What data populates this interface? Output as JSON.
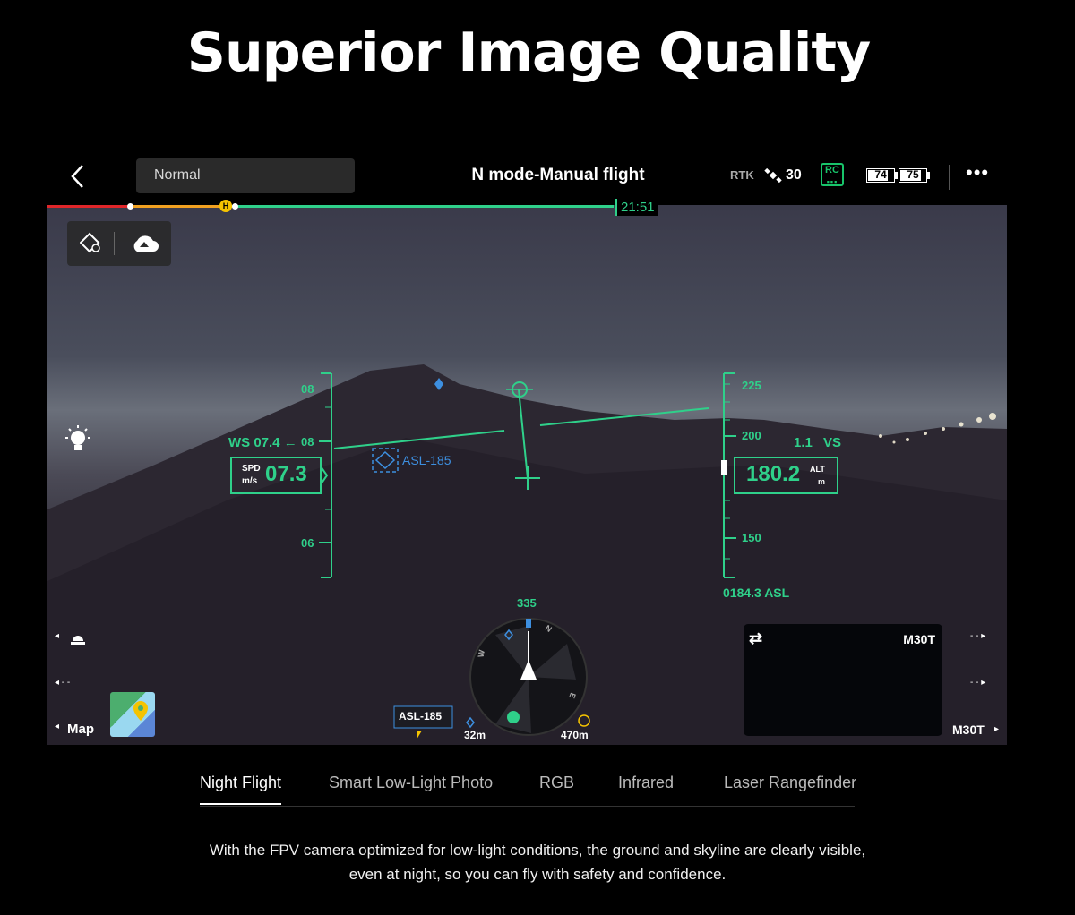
{
  "page": {
    "title": "Superior Image Quality",
    "description_line1": "With the FPV camera optimized for low-light conditions, the ground and skyline are clearly visible,",
    "description_line2": "even at night, so you can fly with safety and confidence."
  },
  "topbar": {
    "back_icon": "chevron-left-icon",
    "mode_value": "Normal",
    "flight_mode": "N mode-Manual flight",
    "rtk_label": "RTK",
    "satellite_count": "30",
    "rc_label": "RC",
    "battery_left": "74",
    "battery_right": "75",
    "more_icon": "more-dots-icon"
  },
  "progress": {
    "home_marker": "H",
    "time_remaining": "21:51"
  },
  "hud": {
    "ws_label": "WS 07.4 ←",
    "speed_label": "SPD",
    "speed_unit": "m/s",
    "speed_value": "07.3",
    "speed_ticks": [
      "08",
      "06"
    ],
    "speed_top_tick": "08",
    "alt_ticks": [
      "225",
      "200",
      "150"
    ],
    "vs_value": "1.1",
    "vs_label": "VS",
    "alt_value": "180.2",
    "alt_label": "ALT",
    "alt_unit": "m",
    "asl_readout": "0184.3 ASL",
    "asl_marker": "ASL-185",
    "heading": "335",
    "compass_n": "N",
    "compass_w": "W",
    "compass_e": "E",
    "bottom_asl_tag": "ASL-185",
    "dist_1": "32m",
    "dist_2": "470m"
  },
  "left_controls": {
    "map_label": "Map",
    "light_icon": "light-bulb-icon",
    "beacon_icon": "beacon-icon"
  },
  "pip": {
    "swap_icon": "swap-icon",
    "camera_label": "M30T",
    "bottom_label": "M30T"
  },
  "tabs": [
    {
      "label": "Night Flight"
    },
    {
      "label": "Smart Low-Light Photo"
    },
    {
      "label": "RGB"
    },
    {
      "label": "Infrared"
    },
    {
      "label": "Laser Rangefinder"
    }
  ],
  "colors": {
    "hud_green": "#2fd08a",
    "hud_blue": "#3d8fe0",
    "home_yellow": "#f5c300",
    "progress_red": "#e0262a",
    "progress_orange": "#f0a020"
  }
}
